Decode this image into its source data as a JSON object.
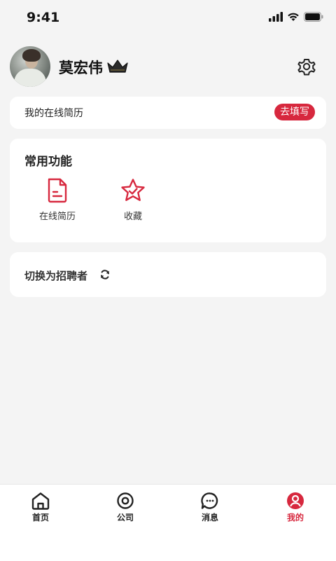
{
  "status_bar": {
    "time": "9:41"
  },
  "profile": {
    "name": "莫宏伟"
  },
  "resume_bar": {
    "label": "我的在线简历",
    "action": "去填写"
  },
  "features": {
    "title": "常用功能",
    "items": [
      {
        "label": "在线简历",
        "icon": "document-icon"
      },
      {
        "label": "收藏",
        "icon": "star-icon"
      }
    ]
  },
  "switch_role": {
    "label": "切换为招聘者"
  },
  "tabbar": {
    "items": [
      {
        "label": "首页",
        "icon": "home-icon"
      },
      {
        "label": "公司",
        "icon": "company-icon"
      },
      {
        "label": "消息",
        "icon": "message-icon"
      },
      {
        "label": "我的",
        "icon": "profile-icon",
        "active": true
      }
    ]
  },
  "colors": {
    "accent": "#d7283e",
    "background": "#f4f4f4",
    "card": "#ffffff"
  }
}
